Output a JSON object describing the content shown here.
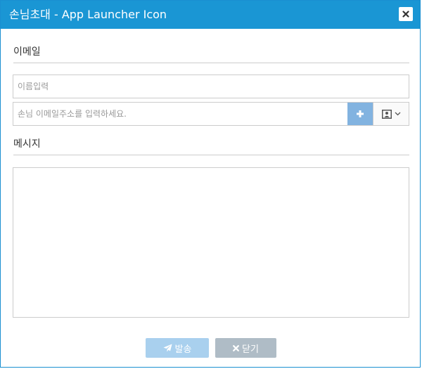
{
  "dialog": {
    "title": "손님초대 - App Launcher Icon"
  },
  "email_section": {
    "label": "이메일",
    "name_placeholder": "이름입력",
    "email_placeholder": "손님 이메일주소를 입력하세요."
  },
  "message_section": {
    "label": "메시지",
    "value": ""
  },
  "footer": {
    "send_label": "발송",
    "close_label": "닫기"
  },
  "colors": {
    "titlebar": "#1a96d4",
    "plus_button": "#82b3e0",
    "send_button": "#a9d0ee",
    "close_button": "#afbcc6"
  },
  "icons": [
    "close-icon",
    "plus-icon",
    "contact-card-icon",
    "chevron-down-icon",
    "paper-plane-icon",
    "x-icon"
  ]
}
